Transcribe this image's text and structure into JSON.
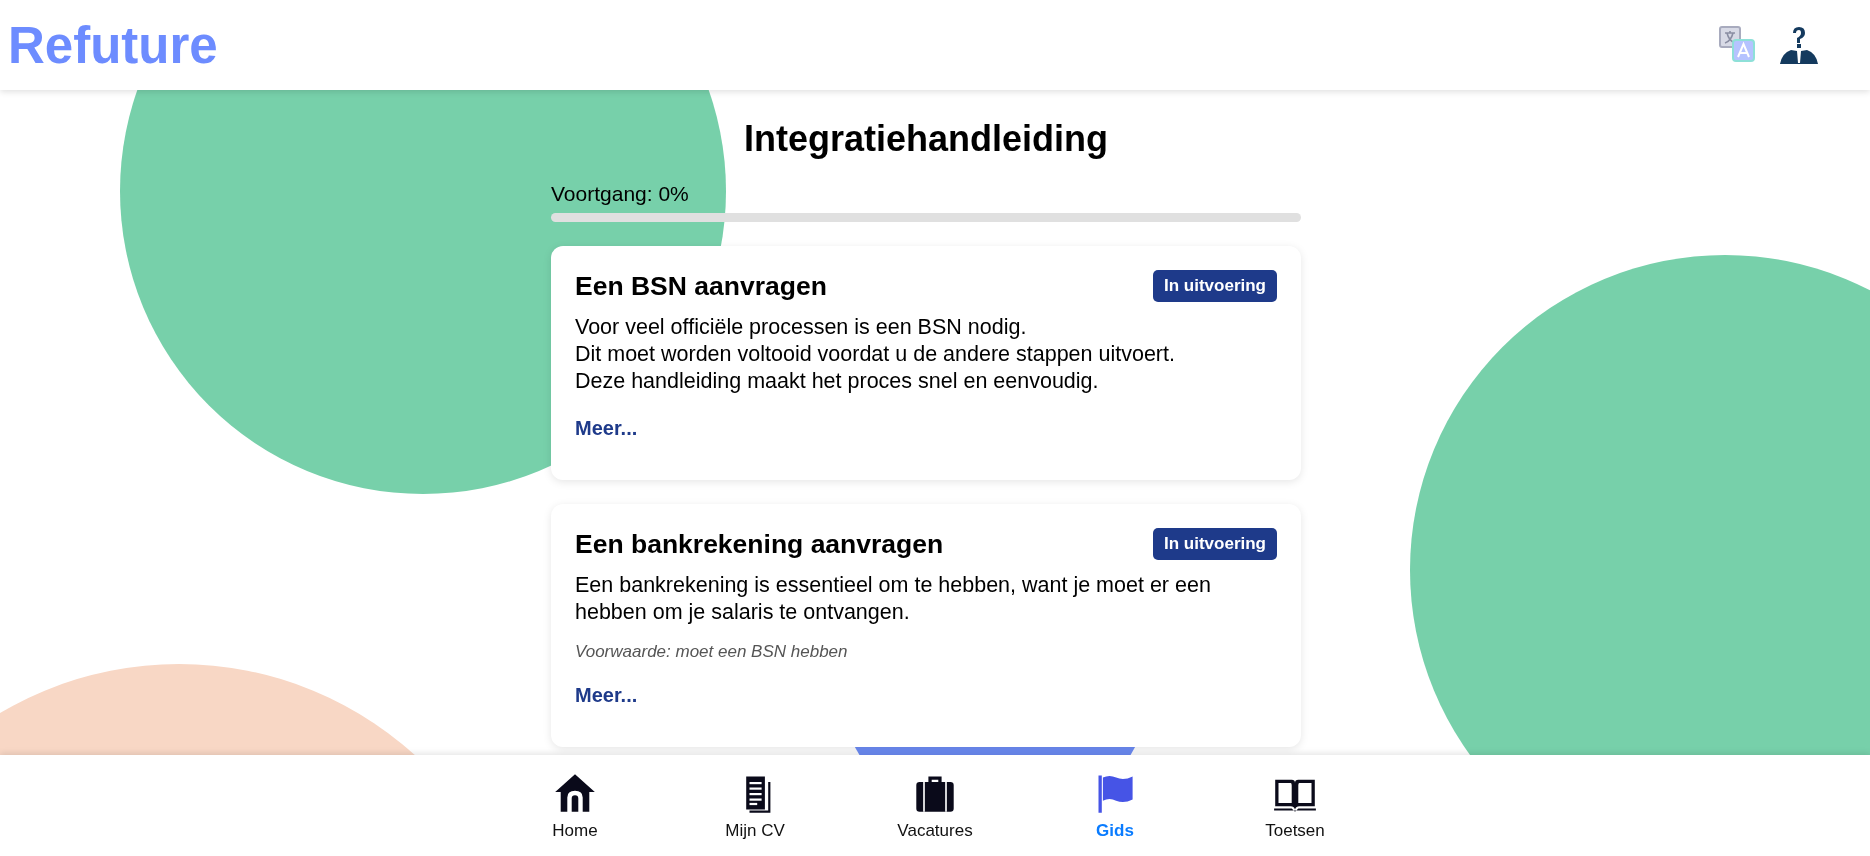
{
  "header": {
    "logo": "Refuture"
  },
  "page": {
    "title": "Integratiehandleiding",
    "progress": {
      "label": "Voortgang: 0%",
      "level": 0
    }
  },
  "steps": [
    {
      "title": "Een BSN aanvragen",
      "status": "In uitvoering",
      "description": [
        "Voor veel officiële processen is een BSN nodig.",
        "Dit moet worden voltooid voordat u de andere stappen uitvoert.",
        "Deze handleiding maakt het proces snel en eenvoudig."
      ],
      "link": "Meer..."
    },
    {
      "title": "Een bankrekening aanvragen",
      "status": "In uitvoering",
      "description": [
        "Een bankrekening is essentieel om te hebben, want je moet er een hebben om je salaris te ontvangen."
      ],
      "prerequisite": "Voorwaarde: moet een BSN hebben",
      "link": "Meer..."
    }
  ],
  "nav": [
    {
      "label": "Home",
      "kind": "home",
      "selected": false
    },
    {
      "label": "Mijn CV",
      "kind": "document",
      "selected": false
    },
    {
      "label": "Vacatures",
      "kind": "briefcase",
      "selected": false
    },
    {
      "label": "Gids",
      "kind": "flag",
      "selected": true
    },
    {
      "label": "Toetsen",
      "kind": "book",
      "selected": false
    }
  ]
}
